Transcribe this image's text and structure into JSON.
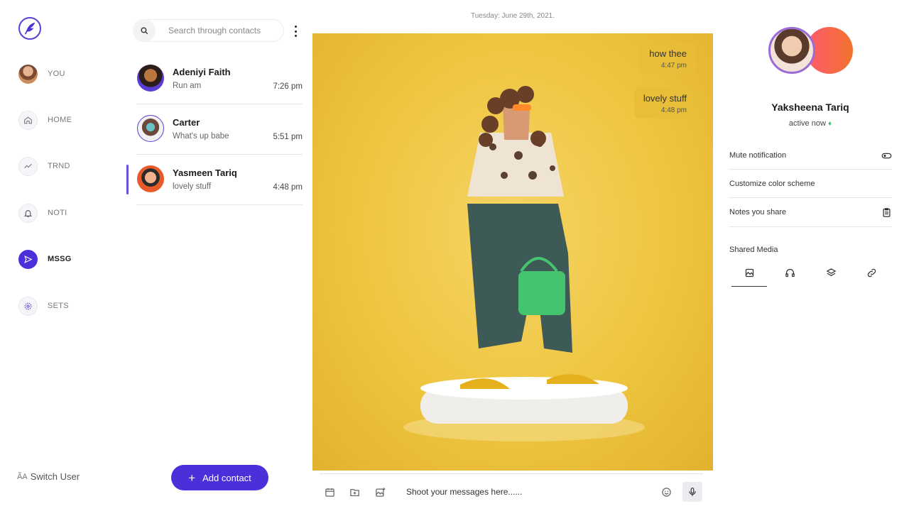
{
  "nav": {
    "items": [
      {
        "label": "YOU",
        "icon": "user-avatar"
      },
      {
        "label": "HOME",
        "icon": "home-icon"
      },
      {
        "label": "TRND",
        "icon": "trend-icon"
      },
      {
        "label": "NOTI",
        "icon": "bell-icon"
      },
      {
        "label": "MSSG",
        "icon": "send-icon",
        "active": true
      },
      {
        "label": "SETS",
        "icon": "settings-icon"
      }
    ],
    "switch_user_label": "Switch User"
  },
  "search": {
    "placeholder": "Search through contacts"
  },
  "contacts": [
    {
      "name": "Adeniyi Faith",
      "preview": "Run am",
      "time": "7:26 pm"
    },
    {
      "name": "Carter",
      "preview": "What's up babe",
      "time": "5:51 pm"
    },
    {
      "name": "Yasmeen Tariq",
      "preview": "lovely stuff",
      "time": "4:48 pm",
      "active": true
    }
  ],
  "add_contact_label": "Add contact",
  "chat": {
    "date": "Tuesday: June 29th, 2021.",
    "messages": [
      {
        "text": "how thee",
        "time": "4:47 pm"
      },
      {
        "text": "lovely stuff",
        "time": "4:48 pm"
      }
    ],
    "composer_placeholder": "Shoot your messages here......"
  },
  "profile": {
    "name": "Yaksheena Tariq",
    "status": "active now",
    "options": [
      {
        "label": "Mute notification",
        "icon": "toggle-icon"
      },
      {
        "label": "Customize color scheme",
        "icon": ""
      },
      {
        "label": "Notes you share",
        "icon": "clipboard-icon"
      }
    ],
    "shared_media_title": "Shared Media",
    "media_tabs": [
      "image-icon",
      "headphones-icon",
      "layers-icon",
      "link-icon"
    ]
  },
  "colors": {
    "accent": "#4b2fd8",
    "chat_bg": "#eec53f",
    "status_dot": "#3cc37a"
  }
}
